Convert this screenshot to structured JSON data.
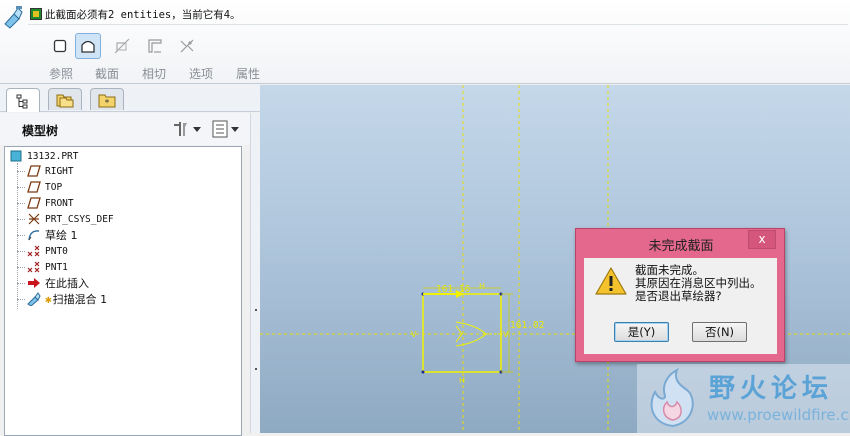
{
  "dashboard": {
    "message": "此截面必须有2 entities，当前它有4。",
    "tabs": [
      "参照",
      "截面",
      "相切",
      "选项",
      "属性"
    ],
    "tool_icons": [
      "section-icon",
      "section-active-icon",
      "tangent-icon",
      "options-icon",
      "properties-icon"
    ]
  },
  "navigator": {
    "title": "模型树",
    "tab_icons": [
      "model-tree-icon",
      "folder-browser-icon",
      "favorites-icon"
    ]
  },
  "tree": {
    "items": [
      {
        "label": "13132.PRT",
        "icon": "part-icon"
      },
      {
        "label": "RIGHT",
        "icon": "datum-plane-icon"
      },
      {
        "label": "TOP",
        "icon": "datum-plane-icon"
      },
      {
        "label": "FRONT",
        "icon": "datum-plane-icon"
      },
      {
        "label": "PRT_CSYS_DEF",
        "icon": "csys-icon"
      },
      {
        "label": "草绘 1",
        "icon": "sketch-icon"
      },
      {
        "label": "PNT0",
        "icon": "datum-point-icon"
      },
      {
        "label": "PNT1",
        "icon": "datum-point-icon"
      },
      {
        "label": "在此插入",
        "icon": "insert-here-arrow-icon"
      },
      {
        "label": "扫描混合 1",
        "icon": "swept-blend-icon"
      }
    ]
  },
  "sketch": {
    "dim_top": "161.16",
    "dim_right": "161.02",
    "label_h_top": "H",
    "label_h_bottom": "H",
    "label_v_left": "V",
    "label_v_right": "V"
  },
  "dialog": {
    "title": "未完成截面",
    "close": "x",
    "lines": [
      "截面未完成。",
      "其原因在消息区中列出。",
      "是否退出草绘器?"
    ],
    "yes_label": "是(Y)",
    "no_label": "否(N)"
  },
  "watermark": {
    "title": "野火论坛",
    "url": "www.proewildfire.cn"
  },
  "colors": {
    "dialog_frame": "#e4678e",
    "sketch_yellow": "#f2f200",
    "canvas_top": "#c5d8ea",
    "canvas_bottom": "#8ea9c2"
  }
}
